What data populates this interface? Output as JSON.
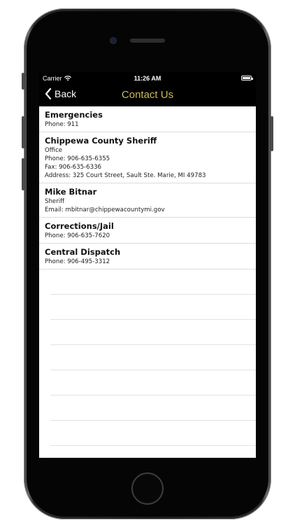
{
  "status_bar": {
    "carrier": "Carrier",
    "time": "11:26 AM"
  },
  "nav": {
    "back_label": "Back",
    "title": "Contact Us",
    "title_color": "#c9bb5a"
  },
  "contacts": [
    {
      "name": "Emergencies",
      "lines": [
        "Phone: 911"
      ]
    },
    {
      "name": "Chippewa County Sheriff",
      "lines": [
        "Office",
        "Phone: 906-635-6355",
        "Fax: 906-635-6336",
        "Address: 325 Court Street, Sault Ste. Marie, MI 49783"
      ]
    },
    {
      "name": "Mike Bitnar",
      "lines": [
        "Sheriff",
        "Email: mbitnar@chippewacountymi.gov"
      ]
    },
    {
      "name": "Corrections/Jail",
      "lines": [
        "Phone: 906-635-7620"
      ]
    },
    {
      "name": "Central Dispatch",
      "lines": [
        "Phone: 906-495-3312"
      ]
    }
  ]
}
